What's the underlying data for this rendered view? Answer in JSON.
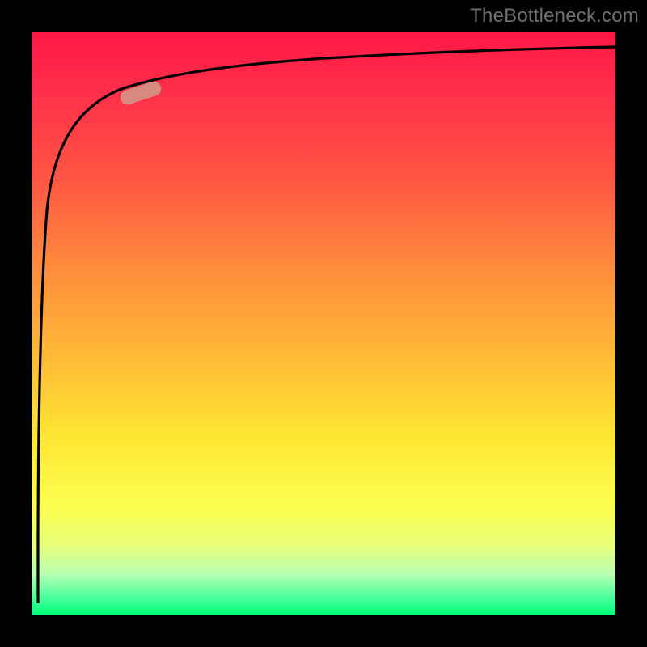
{
  "watermark": "TheBottleneck.com",
  "chart_data": {
    "type": "line",
    "title": "",
    "xlabel": "",
    "ylabel": "",
    "xlim": [
      0,
      100
    ],
    "ylim": [
      0,
      100
    ],
    "grid": false,
    "legend": false,
    "background_gradient": {
      "orientation": "vertical",
      "stops": [
        {
          "pos": 0.0,
          "color": "#ff1846",
          "meaning": "top (high bottleneck)"
        },
        {
          "pos": 0.5,
          "color": "#ffb836"
        },
        {
          "pos": 0.8,
          "color": "#fcff52"
        },
        {
          "pos": 1.0,
          "color": "#00ff78",
          "meaning": "bottom (no bottleneck)"
        }
      ]
    },
    "series": [
      {
        "name": "bottleneck-curve",
        "color": "#000000",
        "x": [
          1,
          2,
          3,
          4,
          5,
          6,
          8,
          10,
          12,
          15,
          18,
          22,
          28,
          35,
          45,
          60,
          80,
          100
        ],
        "y": [
          2,
          35,
          55,
          66,
          73,
          78,
          84,
          87,
          89,
          90.5,
          91.5,
          92.5,
          93.3,
          94,
          94.7,
          95.3,
          95.8,
          96.2
        ]
      }
    ],
    "marker": {
      "name": "highlight-segment",
      "x": 18,
      "y": 91,
      "angle_deg": -18,
      "color": "#d88a80"
    }
  },
  "colors": {
    "frame": "#000000",
    "curve": "#000000",
    "marker": "#d88a80",
    "bg_top": "#ff1846",
    "bg_bottom": "#00ff78"
  }
}
